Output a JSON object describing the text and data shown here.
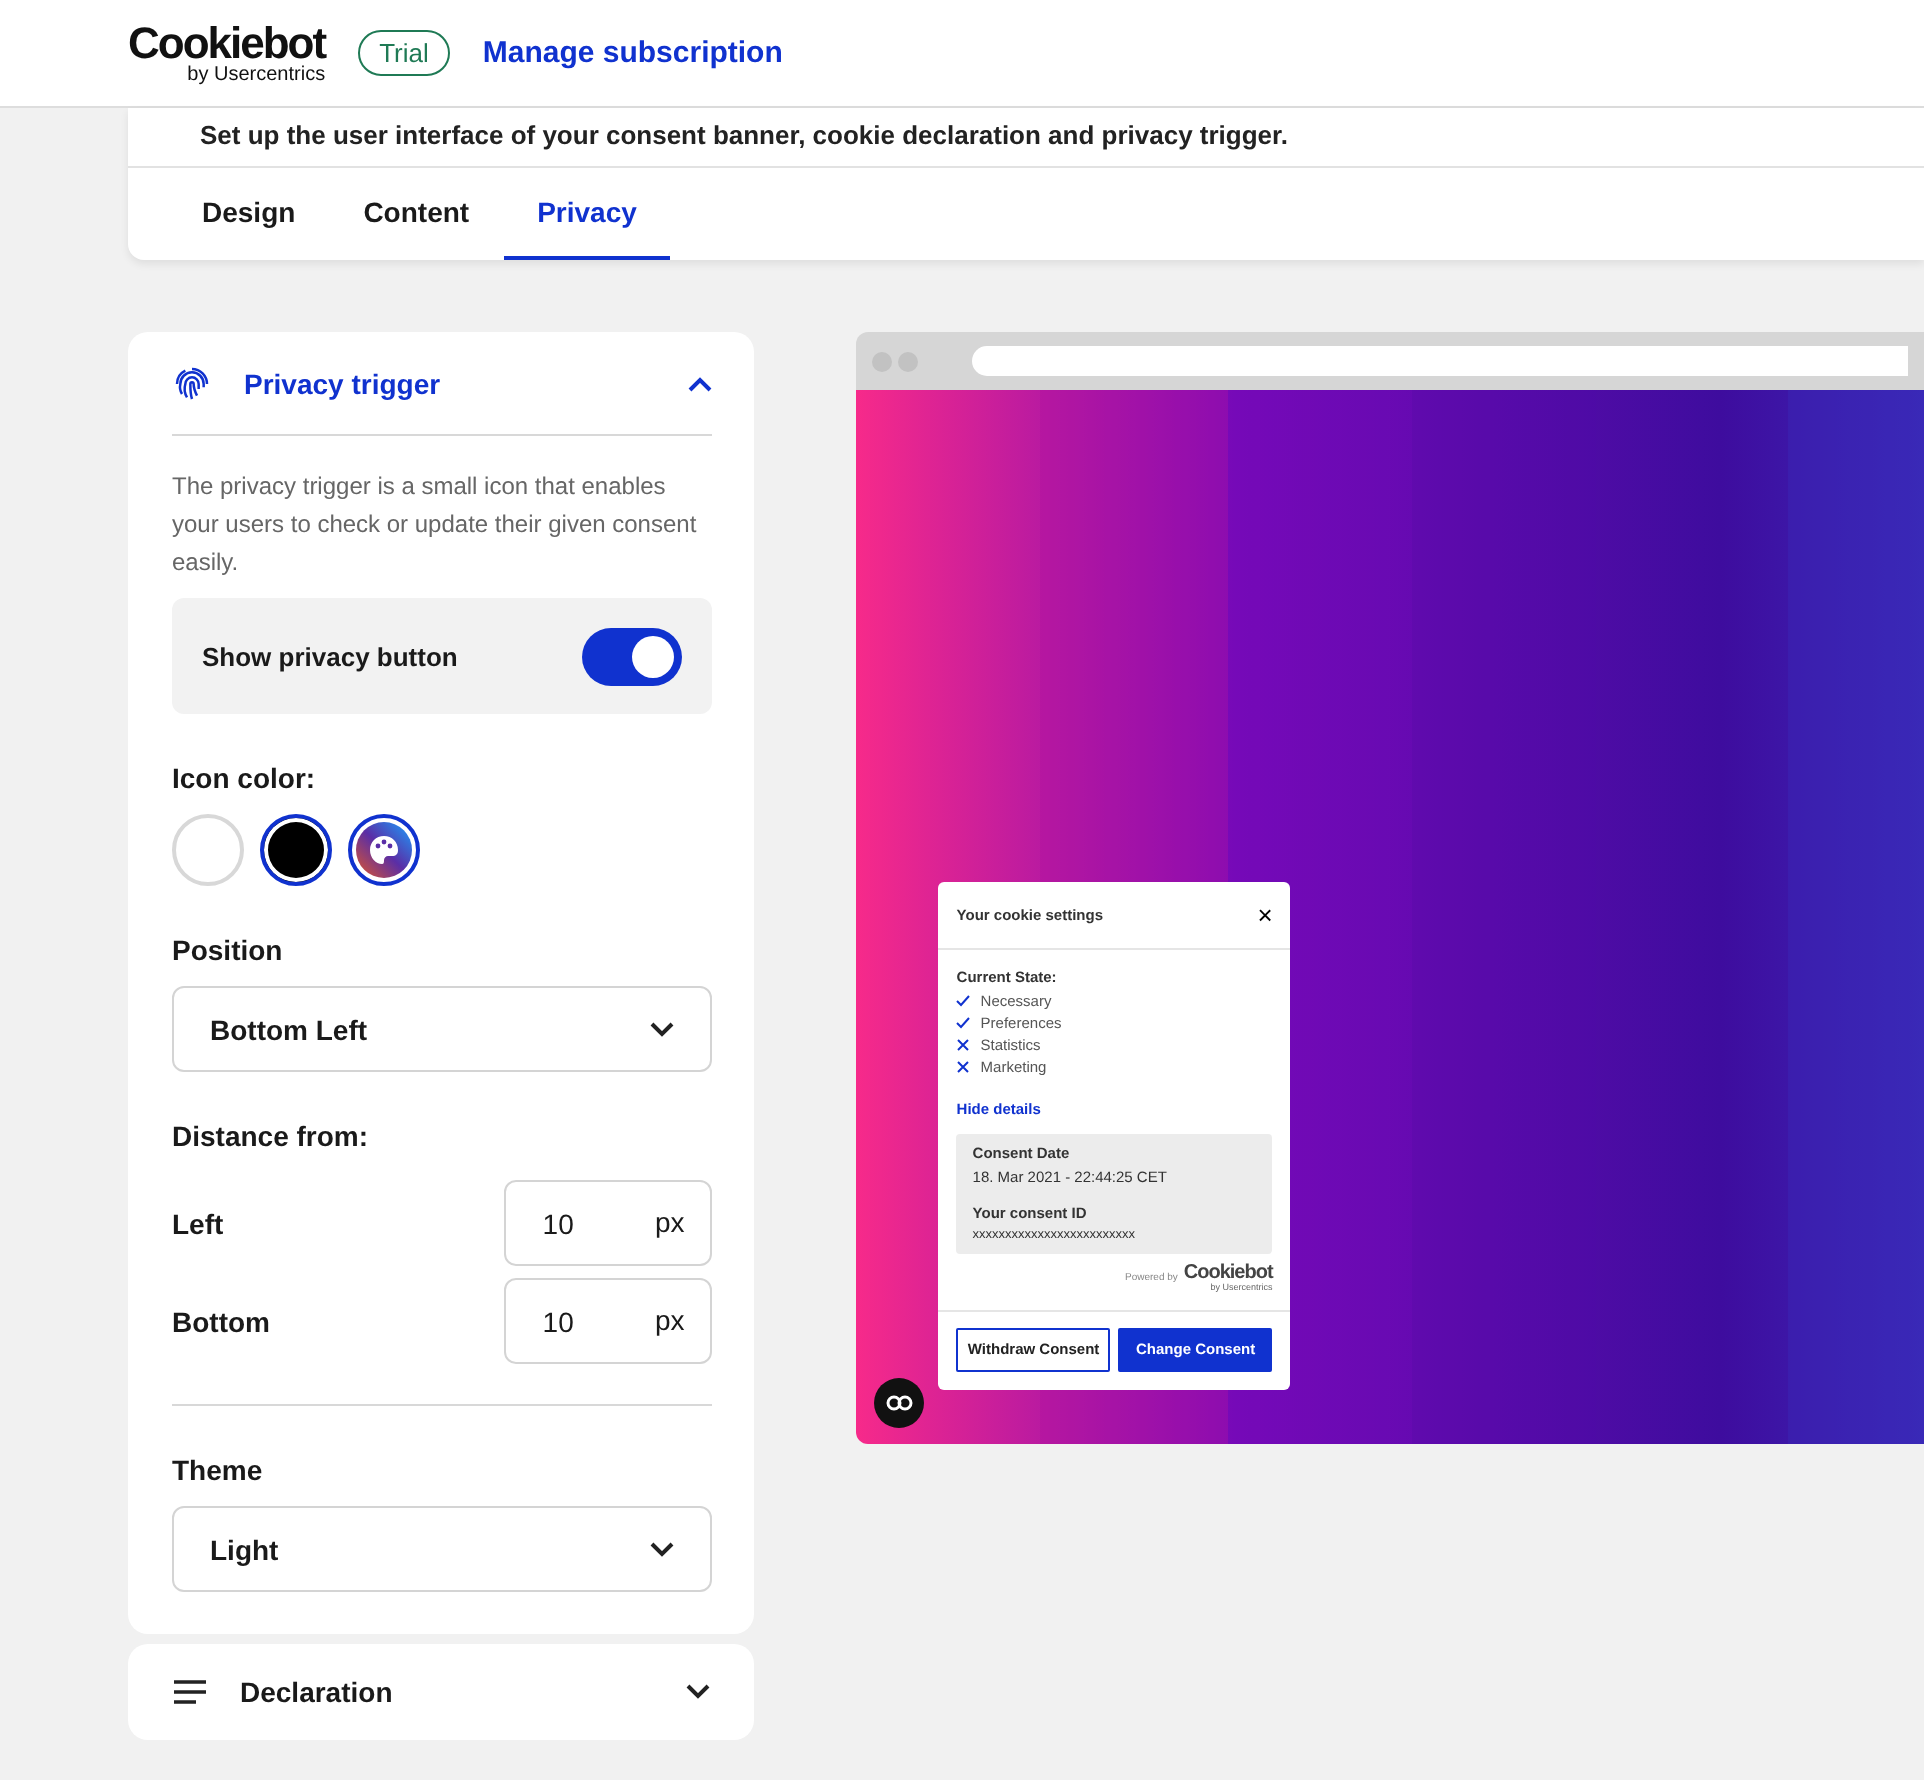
{
  "header": {
    "logo": "Cookiebot",
    "logo_sub": "by Usercentrics",
    "badge": "Trial",
    "link": "Manage subscription"
  },
  "intro": "Set up the user interface of your consent banner, cookie declaration and privacy trigger.",
  "tabs": [
    {
      "label": "Design",
      "selected": false
    },
    {
      "label": "Content",
      "selected": false
    },
    {
      "label": "Privacy",
      "selected": true
    }
  ],
  "panel": {
    "title": "Privacy trigger",
    "expanded": true,
    "description": "The privacy trigger is a small icon that enables your users to check or update their given consent easily.",
    "toggle": {
      "label": "Show privacy button",
      "on": true
    },
    "icon_color_label": "Icon color:",
    "icon_colors": [
      {
        "kind": "swatch",
        "color": "#ffffff",
        "selected": false
      },
      {
        "kind": "swatch",
        "color": "#000000",
        "selected": true
      },
      {
        "kind": "custom",
        "selected": false
      }
    ],
    "position_label": "Position",
    "position": "Bottom Left",
    "distance_label": "Distance from:",
    "distances": [
      {
        "label": "Left",
        "value": "10",
        "unit": "px"
      },
      {
        "label": "Bottom",
        "value": "10",
        "unit": "px"
      }
    ],
    "theme_label": "Theme",
    "theme": "Light"
  },
  "declaration": {
    "title": "Declaration",
    "expanded": false
  },
  "preview": {
    "dialog": {
      "title": "Your cookie settings",
      "close": "×",
      "state_label": "Current State:",
      "states": [
        {
          "name": "Necessary",
          "allowed": true
        },
        {
          "name": "Preferences",
          "allowed": true
        },
        {
          "name": "Statistics",
          "allowed": false
        },
        {
          "name": "Marketing",
          "allowed": false
        }
      ],
      "details_link": "Hide details",
      "date_label": "Consent Date",
      "date": "18. Mar 2021 - 22:44:25 CET",
      "id_label": "Your consent ID",
      "id": "xxxxxxxxxxxxxxxxxxxxxxxxx",
      "powered": "Powered by",
      "brand": "Cookiebot",
      "brand_sub": "by Usercentrics",
      "buttons": [
        {
          "label": "Withdraw Consent",
          "kind": "secondary"
        },
        {
          "label": "Change Consent",
          "kind": "primary"
        }
      ]
    }
  }
}
